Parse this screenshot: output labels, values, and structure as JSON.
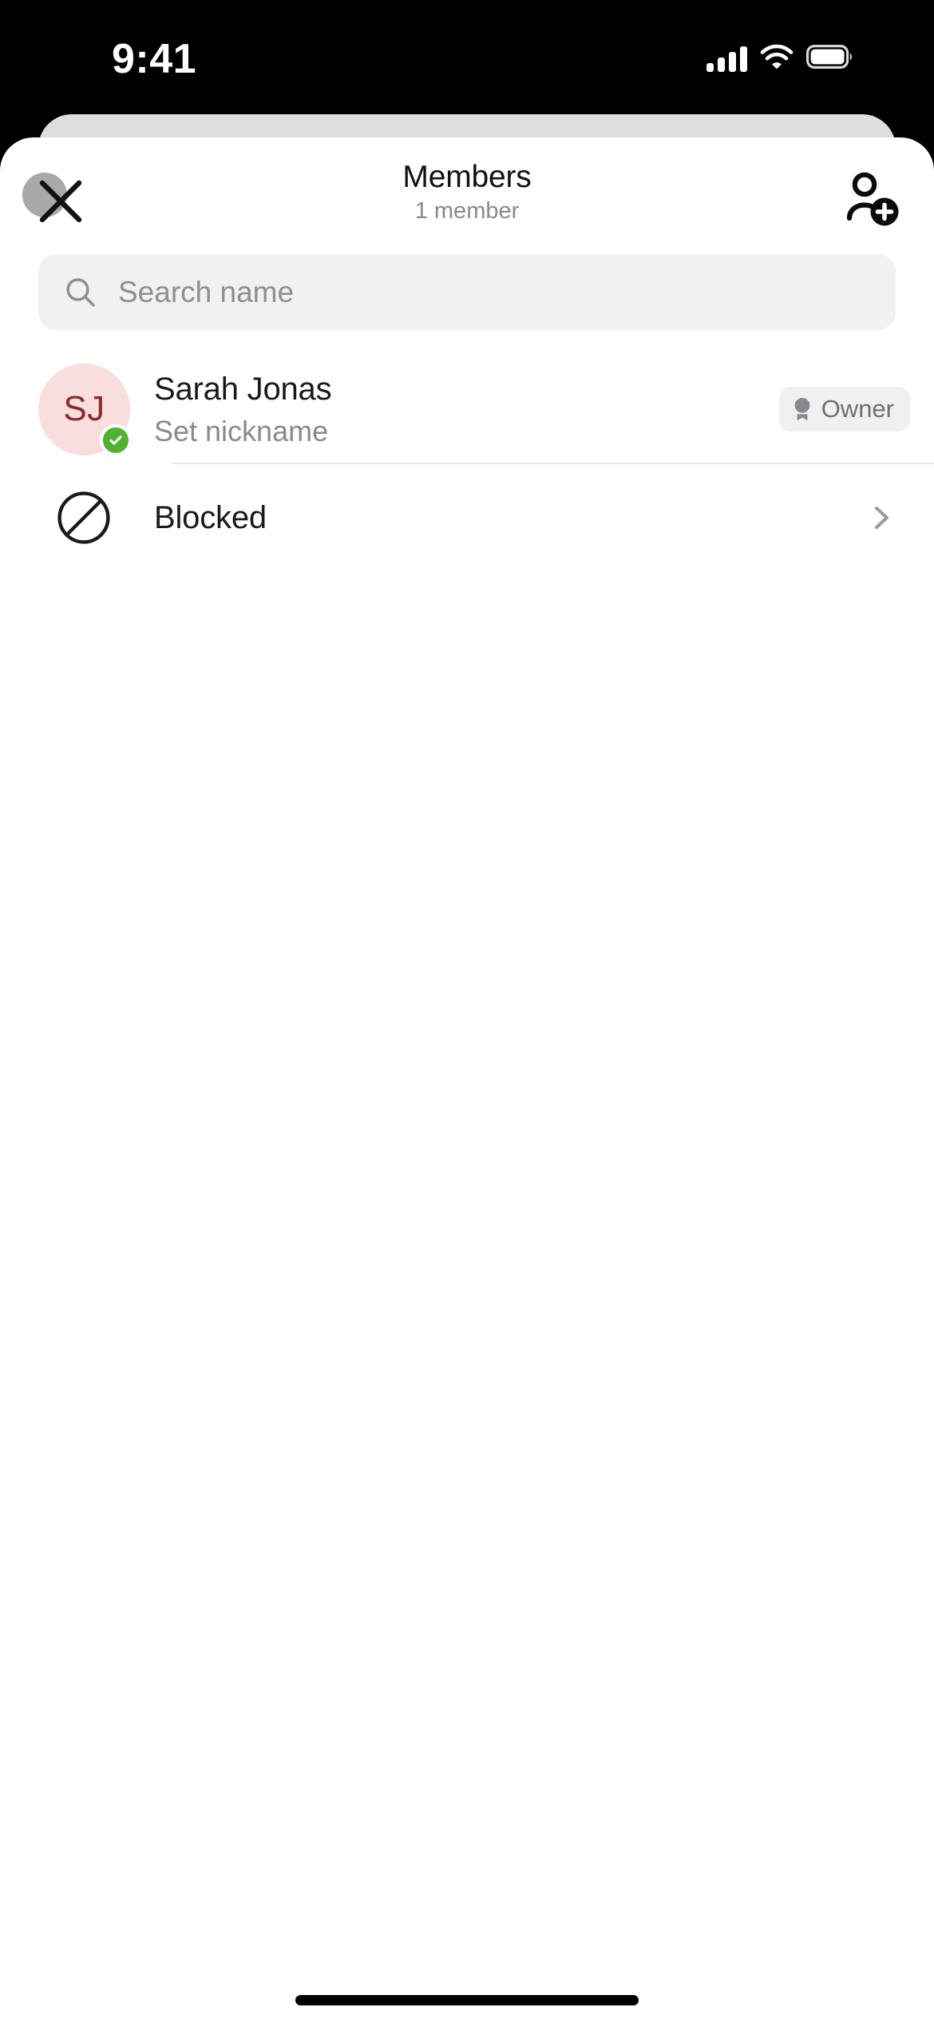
{
  "status_bar": {
    "time": "9:41",
    "cellular_icon": "cellular-signal-icon",
    "wifi_icon": "wifi-icon",
    "battery_icon": "battery-full-icon"
  },
  "header": {
    "title": "Members",
    "subtitle": "1 member",
    "close_icon": "close-x-icon",
    "add_member_icon": "person-add-icon"
  },
  "search": {
    "placeholder": "Search name",
    "value": "",
    "icon": "search-icon"
  },
  "members": [
    {
      "initials": "SJ",
      "name": "Sarah Jonas",
      "nickname": "Set nickname",
      "role_label": "Owner",
      "role_icon": "award-badge-icon",
      "presence": "online",
      "presence_icon": "check-badge-icon",
      "avatar_bg": "#F8DEDC",
      "avatar_fg": "#8A2B2B",
      "presence_color": "#52B032"
    }
  ],
  "blocked": {
    "label": "Blocked",
    "icon": "prohibited-circle-icon",
    "chevron_icon": "chevron-right-icon"
  },
  "colors": {
    "sheet_bg": "#FFFFFF",
    "sheet_behind": "#DEDEE0",
    "backdrop": "#000000",
    "search_bg": "#F1F1F3",
    "badge_bg": "#F0F0F2",
    "muted_text": "#8A8A8E",
    "primary_text": "#1A1A1A",
    "divider": "#E6E6E8"
  },
  "home_indicator": "home-indicator-bar"
}
